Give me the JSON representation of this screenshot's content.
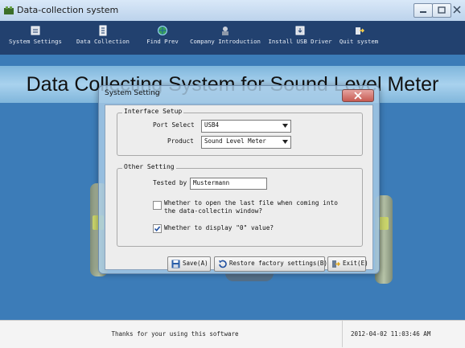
{
  "window": {
    "title": "Data-collection system",
    "controls": [
      "minimize-icon",
      "maximize-icon",
      "close-icon"
    ]
  },
  "toolbar": {
    "items": [
      {
        "label": "System Settings",
        "icon": "settings-icon"
      },
      {
        "label": "Data Collection",
        "icon": "data-collection-icon"
      },
      {
        "label": "Find Prev",
        "icon": "globe-search-icon"
      },
      {
        "label": "Company Introduction",
        "icon": "company-icon"
      },
      {
        "label": "Install USB Driver",
        "icon": "install-icon"
      },
      {
        "label": "Quit system",
        "icon": "exit-icon"
      }
    ]
  },
  "banner": {
    "title": "Data Collecting System for Sound Level Meter"
  },
  "dialog": {
    "title": "System Setting",
    "interface_setup": {
      "legend": "Interface Setup",
      "port_label": "Port Select",
      "port_value": "USB4",
      "product_label": "Product",
      "product_value": "Sound Level Meter"
    },
    "other_setting": {
      "legend": "Other Setting",
      "tested_by_label": "Tested by",
      "tested_by_value": "Mustermann",
      "option1_line1": "Whether to open the last file when coming into",
      "option1_line2": "the data-collectin window?",
      "option1_checked": false,
      "option2_label": "Whether to display \"0\" value?",
      "option2_checked": true
    },
    "buttons": {
      "save": "Save(A)",
      "restore": "Restore factory settings(B)",
      "exit": "Exit(E)"
    }
  },
  "status": {
    "message": "Thanks for your using this software",
    "datetime": "2012-04-02 11:03:46 AM"
  },
  "colors": {
    "toolbar_bg": "#22416f",
    "main_bg": "#3c7cb8",
    "banner_bg": "#a9d2ee",
    "dialog_frame": "#aacde8"
  }
}
